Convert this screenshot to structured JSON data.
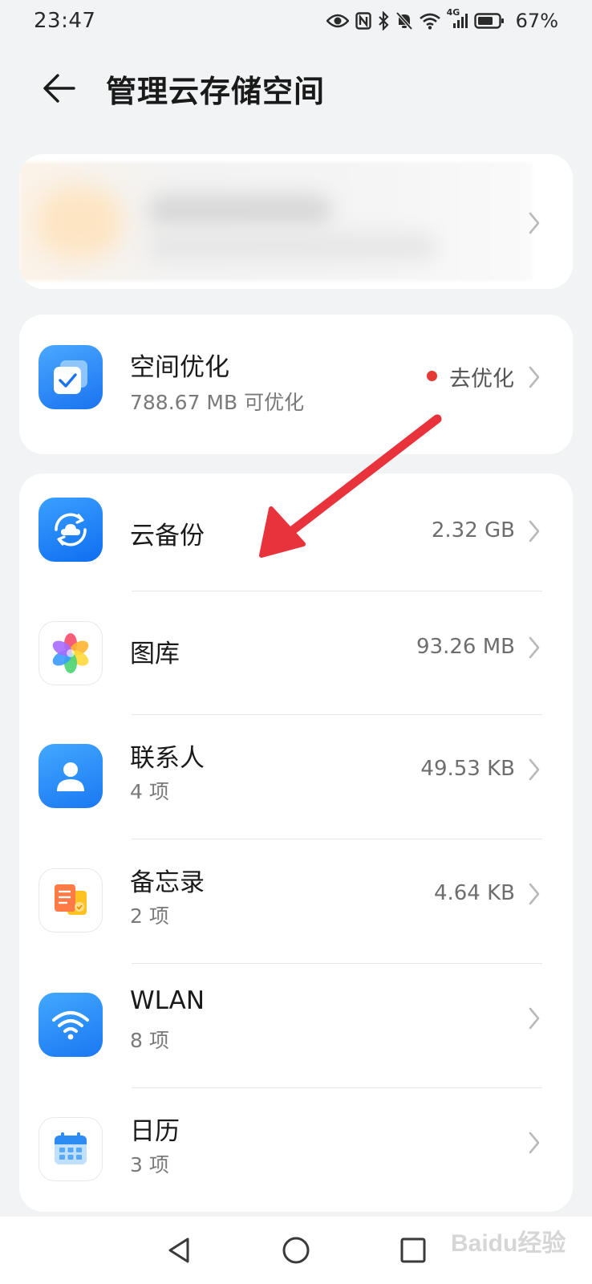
{
  "status_bar": {
    "time": "23:47",
    "battery_percent": "67%",
    "network_label": "4G",
    "icons": [
      "eye-icon",
      "nfc-icon",
      "bluetooth-icon",
      "mute-icon",
      "wifi-icon",
      "signal-icon",
      "battery-icon"
    ]
  },
  "header": {
    "title": "管理云存储空间",
    "back_icon": "back-arrow-icon"
  },
  "account_card": {
    "blurred": true
  },
  "optimize": {
    "title": "空间优化",
    "subtitle": "788.67 MB 可优化",
    "action_label": "去优化",
    "badge_color": "#e53935",
    "icon": "space-optimize-icon"
  },
  "items": [
    {
      "title": "云备份",
      "subtitle": "",
      "value": "2.32 GB",
      "icon": "cloud-backup-icon"
    },
    {
      "title": "图库",
      "subtitle": "",
      "value": "93.26 MB",
      "icon": "gallery-icon"
    },
    {
      "title": "联系人",
      "subtitle": "4 项",
      "value": "49.53 KB",
      "icon": "contacts-icon"
    },
    {
      "title": "备忘录",
      "subtitle": "2 项",
      "value": "4.64 KB",
      "icon": "notes-icon"
    },
    {
      "title": "WLAN",
      "subtitle": "8 项",
      "value": "",
      "icon": "wlan-icon"
    },
    {
      "title": "日历",
      "subtitle": "3 项",
      "value": "",
      "icon": "calendar-icon"
    }
  ],
  "nav": {
    "back": "nav-back-icon",
    "home": "nav-home-icon",
    "recents": "nav-recents-icon"
  },
  "annotation": {
    "arrow_color": "#e8323c"
  },
  "watermark": {
    "text": "Baidu经验"
  },
  "colors": {
    "background": "#f1f3f5",
    "card": "#ffffff",
    "accent_blue": "#1e88f5"
  }
}
